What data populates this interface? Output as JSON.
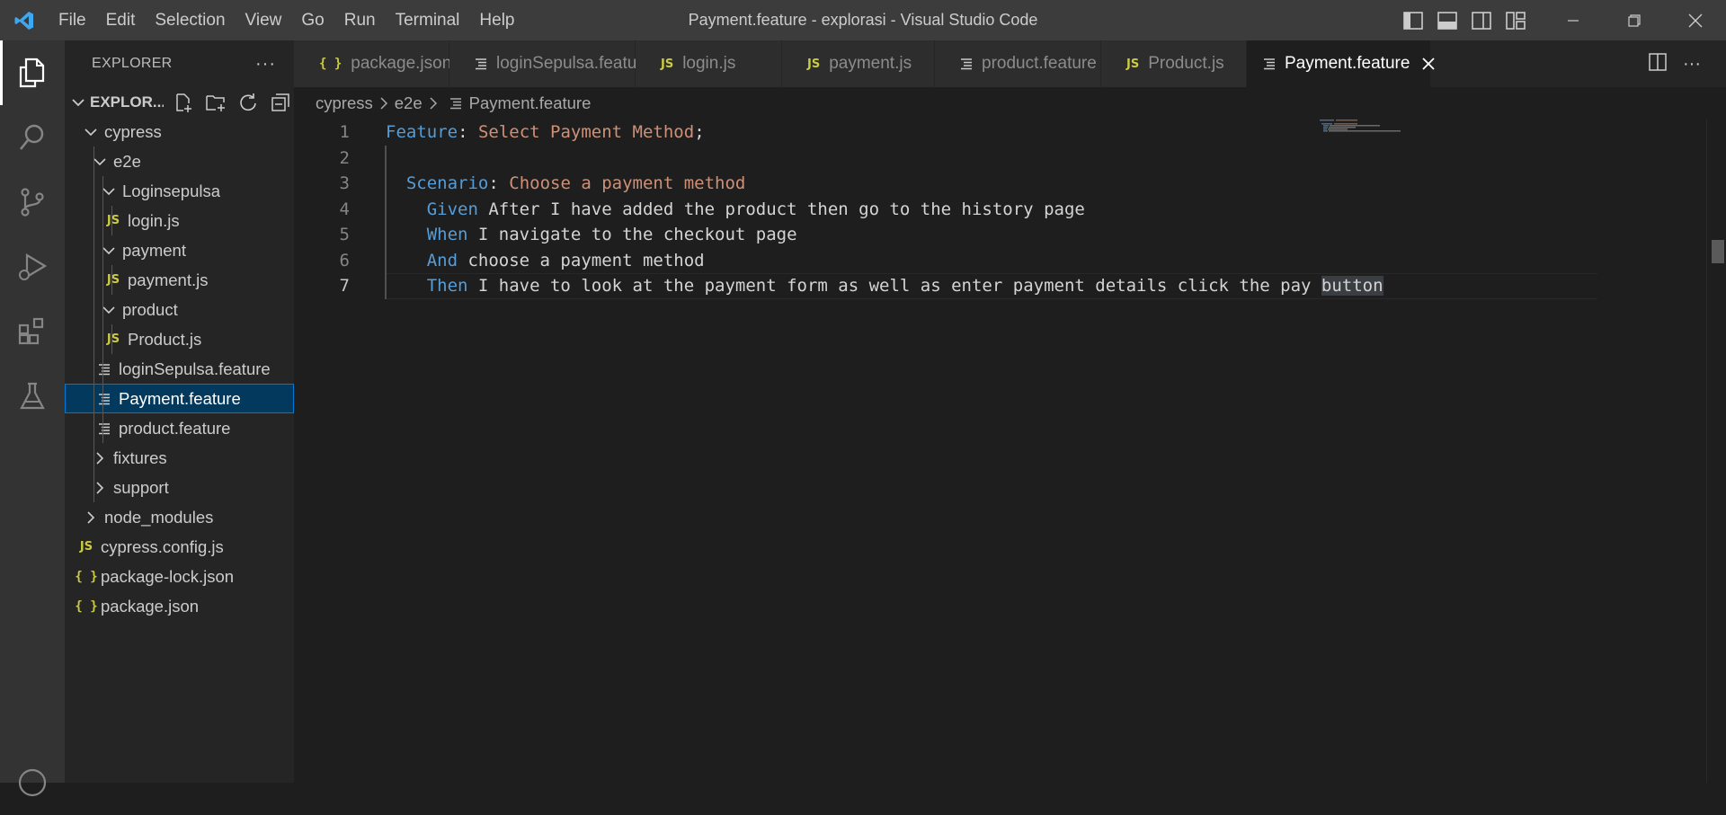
{
  "window": {
    "title": "Payment.feature - explorasi - Visual Studio Code",
    "menu": [
      "File",
      "Edit",
      "Selection",
      "View",
      "Go",
      "Run",
      "Terminal",
      "Help"
    ]
  },
  "sidebar": {
    "header": "EXPLORER",
    "section": "EXPLOR...",
    "tree": [
      {
        "label": "cypress",
        "type": "folder",
        "open": true,
        "depth": 0
      },
      {
        "label": "e2e",
        "type": "folder",
        "open": true,
        "depth": 1
      },
      {
        "label": "Loginsepulsa",
        "type": "folder",
        "open": true,
        "depth": 2
      },
      {
        "label": "login.js",
        "type": "js",
        "depth": 3
      },
      {
        "label": "payment",
        "type": "folder",
        "open": true,
        "depth": 2
      },
      {
        "label": "payment.js",
        "type": "js",
        "depth": 3
      },
      {
        "label": "product",
        "type": "folder",
        "open": true,
        "depth": 2
      },
      {
        "label": "Product.js",
        "type": "js",
        "depth": 3
      },
      {
        "label": "loginSepulsa.feature",
        "type": "feature",
        "depth": 2
      },
      {
        "label": "Payment.feature",
        "type": "feature",
        "depth": 2,
        "selected": true
      },
      {
        "label": "product.feature",
        "type": "feature",
        "depth": 2
      },
      {
        "label": "fixtures",
        "type": "folder",
        "open": false,
        "depth": 1
      },
      {
        "label": "support",
        "type": "folder",
        "open": false,
        "depth": 1
      },
      {
        "label": "node_modules",
        "type": "folder",
        "open": false,
        "depth": 0
      },
      {
        "label": "cypress.config.js",
        "type": "js",
        "depth": 0
      },
      {
        "label": "package-lock.json",
        "type": "json",
        "depth": 0
      },
      {
        "label": "package.json",
        "type": "json",
        "depth": 0
      }
    ]
  },
  "tabs": [
    {
      "label": "package.json",
      "type": "json"
    },
    {
      "label": "loginSepulsa.feature",
      "type": "feature"
    },
    {
      "label": "login.js",
      "type": "js"
    },
    {
      "label": "payment.js",
      "type": "js"
    },
    {
      "label": "product.feature",
      "type": "feature"
    },
    {
      "label": "Product.js",
      "type": "js"
    },
    {
      "label": "Payment.feature",
      "type": "feature",
      "active": true
    }
  ],
  "icons": {
    "js": "JS",
    "json": "{ }"
  },
  "breadcrumb": [
    "cypress",
    "e2e",
    "Payment.feature"
  ],
  "editor": {
    "current_line": 7,
    "lines": [
      {
        "n": "1",
        "kw": "Feature",
        "rest": ": ",
        "str": "Select Payment Method",
        "tail": ";"
      },
      {
        "n": "2",
        "kw": "",
        "rest": "",
        "str": "",
        "tail": ""
      },
      {
        "n": "3",
        "kw": "Scenario",
        "rest": ": ",
        "str": "Choose a payment method",
        "tail": ""
      },
      {
        "n": "4",
        "kw": "Given",
        "rest": " After I have added the product then go to the history page",
        "str": "",
        "tail": ""
      },
      {
        "n": "5",
        "kw": "When",
        "rest": " I navigate to the checkout page",
        "str": "",
        "tail": ""
      },
      {
        "n": "6",
        "kw": "And",
        "rest": " choose a payment method",
        "str": "",
        "tail": ""
      },
      {
        "n": "7",
        "kw": "Then",
        "rest": " I have to look at the payment form as well as enter payment details click the pay ",
        "str": "",
        "tail": "",
        "highlight": "button"
      }
    ]
  },
  "colors": {
    "keyword": "#569cd6",
    "string": "#ce9178",
    "selection_bg": "#04395e",
    "js_icon": "#cbcb41"
  }
}
